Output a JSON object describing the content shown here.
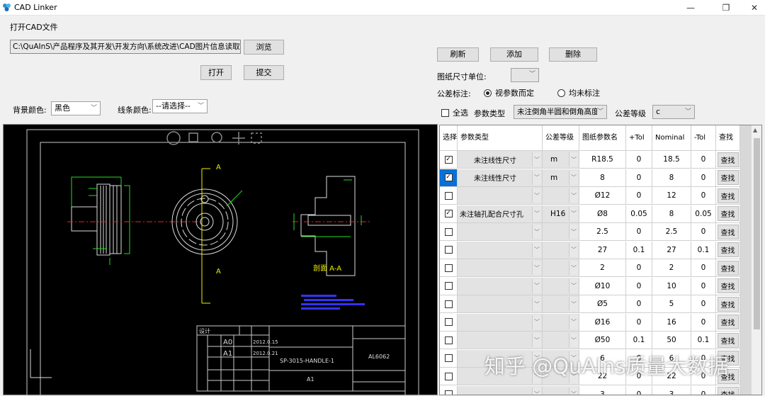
{
  "window": {
    "title": "CAD Linker",
    "minimize": "—",
    "restore": "❐",
    "close": "✕"
  },
  "file": {
    "section_label": "打开CAD文件",
    "path": "C:\\QuAInS\\产品程序及其开发\\开发方向\\系统改进\\CAD图片信息读取\\CAD图纸示例",
    "browse": "浏览",
    "open": "打开",
    "submit": "提交"
  },
  "colors": {
    "bg_label": "背景颜色:",
    "bg_value": "黑色",
    "line_label": "线条颜色:",
    "line_value": "--请选择--"
  },
  "actions": {
    "refresh": "刷新",
    "add": "添加",
    "delete": "删除"
  },
  "unit": {
    "label": "图纸尺寸单位:",
    "value": ""
  },
  "tolerance": {
    "label": "公差标注:",
    "opt1": "视参数而定",
    "opt2": "均未标注",
    "selected": "opt1"
  },
  "filter": {
    "select_all": "全选",
    "param_type_label": "参数类型",
    "param_type_value": "未注倒角半圆和倒角高度",
    "grade_label": "公差等级",
    "grade_value": "c"
  },
  "table": {
    "headers": [
      "选择",
      "参数类型",
      "公差等级",
      "图纸参数名",
      "+Tol",
      "Nominal",
      "-Tol",
      "查找"
    ],
    "find_label": "查找",
    "rows": [
      {
        "checked": true,
        "type": "未注线性尺寸",
        "grade": "m",
        "name": "R18.5",
        "ptol": "0",
        "nominal": "18.5",
        "ntol": "0"
      },
      {
        "checked": true,
        "selected": true,
        "type": "未注线性尺寸",
        "grade": "m",
        "name": "8",
        "ptol": "0",
        "nominal": "8",
        "ntol": "0"
      },
      {
        "checked": false,
        "type": "",
        "grade": "",
        "name": "Ø12",
        "ptol": "0",
        "nominal": "12",
        "ntol": "0"
      },
      {
        "checked": true,
        "type": "未注轴孔配合尺寸孔",
        "grade": "H16",
        "name": "Ø8",
        "ptol": "0.05",
        "nominal": "8",
        "ntol": "0.05"
      },
      {
        "checked": false,
        "type": "",
        "grade": "",
        "name": "2.5",
        "ptol": "0",
        "nominal": "2.5",
        "ntol": "0"
      },
      {
        "checked": false,
        "type": "",
        "grade": "",
        "name": "27",
        "ptol": "0.1",
        "nominal": "27",
        "ntol": "0.1"
      },
      {
        "checked": false,
        "type": "",
        "grade": "",
        "name": "2",
        "ptol": "0",
        "nominal": "2",
        "ntol": "0"
      },
      {
        "checked": false,
        "type": "",
        "grade": "",
        "name": "Ø10",
        "ptol": "0",
        "nominal": "10",
        "ntol": "0"
      },
      {
        "checked": false,
        "type": "",
        "grade": "",
        "name": "Ø5",
        "ptol": "0",
        "nominal": "5",
        "ntol": "0"
      },
      {
        "checked": false,
        "type": "",
        "grade": "",
        "name": "Ø16",
        "ptol": "0",
        "nominal": "16",
        "ntol": "0"
      },
      {
        "checked": false,
        "type": "",
        "grade": "",
        "name": "Ø50",
        "ptol": "0.1",
        "nominal": "50",
        "ntol": "0.1"
      },
      {
        "checked": false,
        "type": "",
        "grade": "",
        "name": "6",
        "ptol": "0",
        "nominal": "6",
        "ntol": "0"
      },
      {
        "checked": false,
        "type": "",
        "grade": "",
        "name": "22",
        "ptol": "0",
        "nominal": "22",
        "ntol": "0"
      },
      {
        "checked": false,
        "type": "",
        "grade": "",
        "name": "3",
        "ptol": "0",
        "nominal": "3",
        "ntol": "0"
      }
    ]
  },
  "drawing": {
    "section_mark": "A",
    "section_title": "剖面 A-A",
    "designer": "设计",
    "rev0": "A0",
    "rev1": "A1",
    "date0": "2012.0.15",
    "date1": "2012.0.21",
    "part_no": "SP-3015-HANDLE-1",
    "material": "AL6062",
    "sheet": "A1"
  },
  "watermark": "知乎 @QuAIns质量大数据"
}
